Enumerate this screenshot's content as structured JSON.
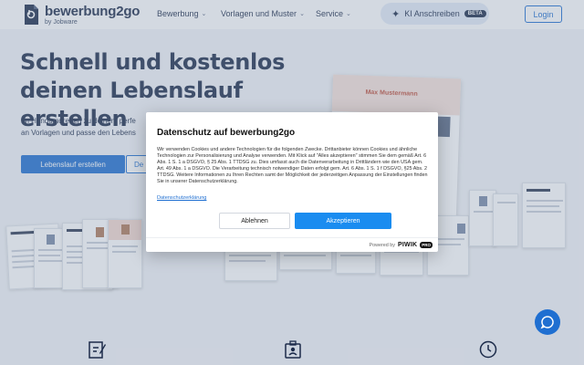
{
  "header": {
    "logo_title": "bewerbung2go",
    "logo_sub": "by Jobware",
    "nav": [
      {
        "label": "Bewerbung"
      },
      {
        "label": "Vorlagen und Muster"
      },
      {
        "label": "Service"
      }
    ],
    "ki_label": "KI Anschreiben",
    "beta_label": "BETA",
    "login_label": "Login"
  },
  "hero": {
    "title": "Schnell und kostenlos deinen Lebenslauf erstellen",
    "text_line1": "Im Handumdrehen zu deinem perfe",
    "text_line2": "an Vorlagen und passe den Lebens",
    "cta_label": "Lebenslauf erstellen",
    "cta2_label": "De",
    "preview_name": "Max Mustermann"
  },
  "modal": {
    "title": "Datenschutz auf bewerbung2go",
    "body": "Wir verwenden Cookies und andere Technologien für die folgenden Zwecke. Drittanbieter können Cookies und ähnliche Technologien zur Personalisierung und Analyse verwenden. Mit Klick auf \"Alles akzeptieren\" stimmen Sie dem gemäß Art. 6 Abs. 1 S. 1 a DSGVO, § 25 Abs. 1 TTDSG zu. Dies umfasst auch die Datenverarbeitung in Drittländern wie den USA gem. Art. 49 Abs. 1 a DSGVO. Die Verarbeitung technisch notwendiger Daten erfolgt gem. Art. 6 Abs. 1 S. 1 f DSGVO, §25 Abs. 2 TTDSG. Weitere Informationen zu Ihren Rechten samt der Möglichkeit der jederzeitigen Anpassung der Einstellungen finden Sie in unserer Datenschutzerklärung.",
    "link_label": "Datenschutzerklärung",
    "decline_label": "Ablehnen",
    "accept_label": "Akzeptieren",
    "powered_label": "Powered by",
    "piwik_label": "PIWIK",
    "pro_label": "PRO"
  },
  "icons": {
    "logo": "bewerbung2go-logo-icon",
    "sparkle": "sparkle-icon",
    "chat": "chat-icon",
    "features": [
      "document-edit-icon",
      "briefcase-id-icon",
      "clock-icon"
    ]
  },
  "colors": {
    "primary": "#1f6fd1",
    "navy": "#1c2b4a",
    "accept": "#1a8cf0"
  }
}
